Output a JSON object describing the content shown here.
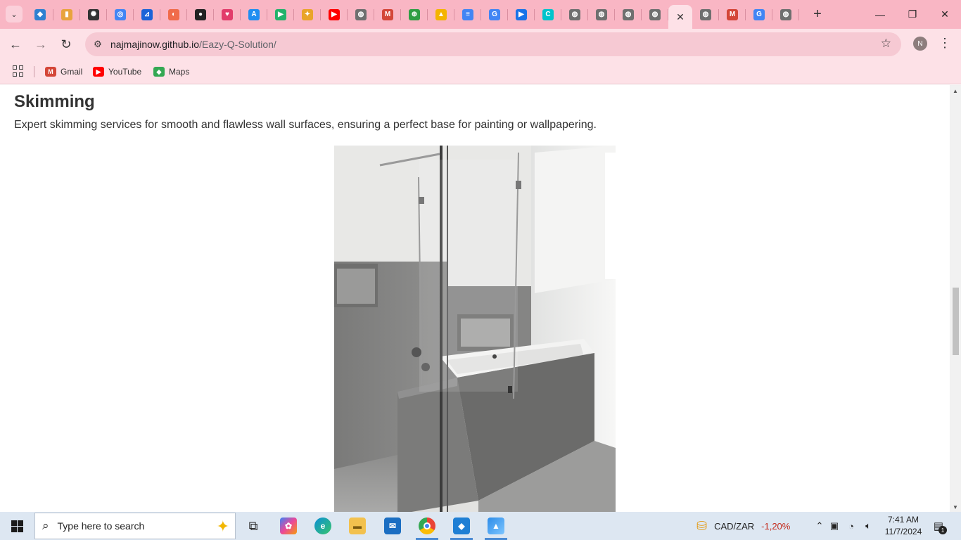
{
  "browser": {
    "tabs": [
      {
        "icon": "vscode-icon",
        "color": "#2f80d1",
        "glyph": "◆"
      },
      {
        "icon": "chart-icon",
        "color": "#e8a33d",
        "glyph": "▮"
      },
      {
        "icon": "openai-icon",
        "color": "#333333",
        "glyph": "✺"
      },
      {
        "icon": "lens-icon",
        "color": "#4285f4",
        "glyph": "◎"
      },
      {
        "icon": "jira-icon",
        "color": "#1d63d8",
        "glyph": "⊿"
      },
      {
        "icon": "app-icon",
        "color": "#f06b4a",
        "glyph": "◐"
      },
      {
        "icon": "github-icon",
        "color": "#222222",
        "glyph": "●"
      },
      {
        "icon": "butterfly-icon",
        "color": "#e23c6b",
        "glyph": "♥"
      },
      {
        "icon": "appstore-icon",
        "color": "#1f8ef1",
        "glyph": "A"
      },
      {
        "icon": "play-icon",
        "color": "#23b26b",
        "glyph": "▶"
      },
      {
        "icon": "pinwheel-icon",
        "color": "#e9a42a",
        "glyph": "✦"
      },
      {
        "icon": "youtube-icon",
        "color": "#ff0000",
        "glyph": "▶"
      },
      {
        "icon": "globe-icon",
        "color": "#6f6f6f",
        "glyph": "◍"
      },
      {
        "icon": "gmail-icon",
        "color": "#d44638",
        "glyph": "M"
      },
      {
        "icon": "extension-icon",
        "color": "#2f9e44",
        "glyph": "⊕"
      },
      {
        "icon": "drive-icon",
        "color": "#f4b400",
        "glyph": "▲"
      },
      {
        "icon": "docs-icon",
        "color": "#4285f4",
        "glyph": "≡"
      },
      {
        "icon": "google-icon",
        "color": "#4285f4",
        "glyph": "G"
      },
      {
        "icon": "play-console-icon",
        "color": "#1a73e8",
        "glyph": "▶"
      },
      {
        "icon": "canva-icon",
        "color": "#00c4cc",
        "glyph": "C"
      },
      {
        "icon": "globe-icon",
        "color": "#6f6f6f",
        "glyph": "◍"
      },
      {
        "icon": "globe-icon",
        "color": "#6f6f6f",
        "glyph": "◍"
      },
      {
        "icon": "globe-icon",
        "color": "#6f6f6f",
        "glyph": "◍"
      },
      {
        "icon": "globe-icon",
        "color": "#6f6f6f",
        "glyph": "◍"
      }
    ],
    "tabs_after_active": [
      {
        "icon": "globe-icon",
        "color": "#6f6f6f",
        "glyph": "◍"
      },
      {
        "icon": "gmail-icon",
        "color": "#d44638",
        "glyph": "M"
      },
      {
        "icon": "google-icon",
        "color": "#4285f4",
        "glyph": "G"
      },
      {
        "icon": "globe-icon",
        "color": "#6f6f6f",
        "glyph": "◍"
      }
    ],
    "url_host": "najmajinow.github.io",
    "url_path": "/Eazy-Q-Solution/",
    "profile_initial": "N",
    "bookmarks": [
      {
        "label": "Gmail",
        "icon": "gmail-icon",
        "color": "#d44638",
        "glyph": "M"
      },
      {
        "label": "YouTube",
        "icon": "youtube-icon",
        "color": "#ff0000",
        "glyph": "▶"
      },
      {
        "label": "Maps",
        "icon": "maps-icon",
        "color": "#34a853",
        "glyph": "◆"
      }
    ]
  },
  "content": {
    "section_title": "Skimming",
    "section_description": "Expert skimming services for smooth and flawless wall surfaces, ensuring a perfect base for painting or wallpapering."
  },
  "taskbar": {
    "search_placeholder": "Type here to search",
    "ticker_pair": "CAD/ZAR",
    "ticker_change": "-1,20%",
    "ticker_color": "#c42b1c",
    "time": "7:41 AM",
    "date": "11/7/2024",
    "notification_count": "1"
  }
}
